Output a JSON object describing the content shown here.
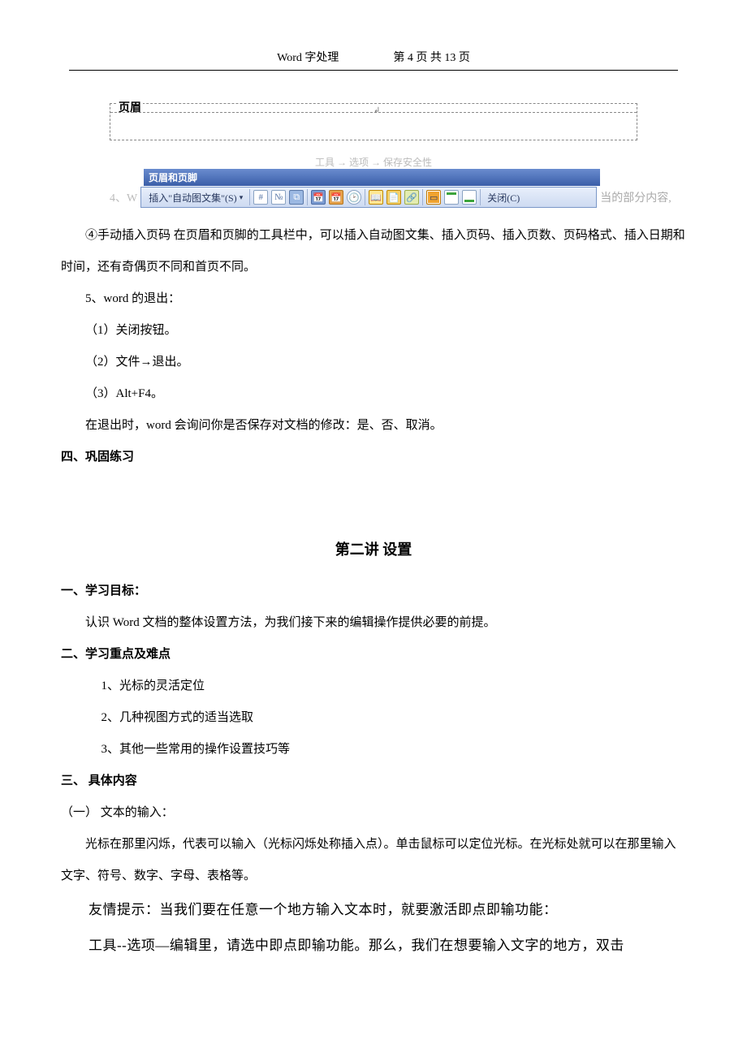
{
  "header": {
    "doc_title": "Word 字处理",
    "page_info": "第 4 页 共 13 页"
  },
  "header_editor": {
    "label": "页眉",
    "faded_menu": "工具 → 选项 → 保存安全性"
  },
  "toolbar": {
    "title": "页眉和页脚",
    "pre_text": "4、W",
    "autotext_label": "插入\"自动图文集\"(S)",
    "close_label": "关闭(C)",
    "post_text": "当的部分内容,"
  },
  "body": {
    "para_insert": "④手动插入页码 在页眉和页脚的工具栏中，可以插入自动图文集、插入页码、插入页数、页码格式、插入日期和时间，还有奇偶页不同和首页不同。",
    "exit_heading": "5、word 的退出：",
    "exit_1": "（1）关闭按钮。",
    "exit_2": "（2）文件→退出。",
    "exit_3": "（3）Alt+F4。",
    "exit_note": "在退出时，word 会询问你是否保存对文档的修改：是、否、取消。"
  },
  "section4": "四、巩固练习",
  "lesson2": {
    "title": "第二讲 设置",
    "s1_head": "一、学习目标：",
    "s1_body": "认识 Word 文档的整体设置方法，为我们接下来的编辑操作提供必要的前提。",
    "s2_head": "二、学习重点及难点",
    "s2_1": "1、光标的灵活定位",
    "s2_2": "2、几种视图方式的适当选取",
    "s2_3": "3、其他一些常用的操作设置技巧等",
    "s3_head": "三、 具体内容",
    "s3_sub": "（一） 文本的输入：",
    "s3_body": "光标在那里闪烁，代表可以输入（光标闪烁处称插入点）。单击鼠标可以定位光标。在光标处就可以在那里输入文字、符号、数字、字母、表格等。",
    "hint1": "友情提示：当我们要在任意一个地方输入文本时，就要激活即点即输功能：",
    "hint2": "工具--选项—编辑里，请选中即点即输功能。那么，我们在想要输入文字的地方，双击"
  }
}
